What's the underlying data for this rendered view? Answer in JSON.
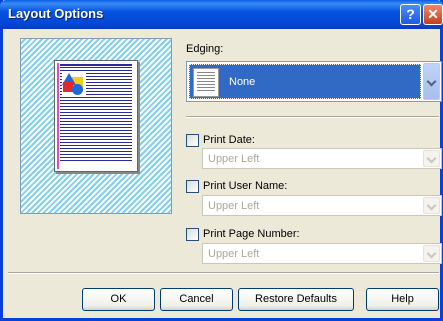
{
  "window": {
    "title": "Layout Options",
    "help_symbol": "?",
    "close_symbol": "✕"
  },
  "edging": {
    "label": "Edging:",
    "selected": "None"
  },
  "options": [
    {
      "label": "Print Date:",
      "checked": false,
      "position_value": "Upper Left"
    },
    {
      "label": "Print User Name:",
      "checked": false,
      "position_value": "Upper Left"
    },
    {
      "label": "Print Page Number:",
      "checked": false,
      "position_value": "Upper Left"
    }
  ],
  "buttons": {
    "ok": "OK",
    "cancel": "Cancel",
    "restore": "Restore Defaults",
    "help": "Help"
  },
  "colors": {
    "titlebar": "#0446d6",
    "selection": "#316ac5",
    "dialog_bg": "#ece9d8"
  }
}
